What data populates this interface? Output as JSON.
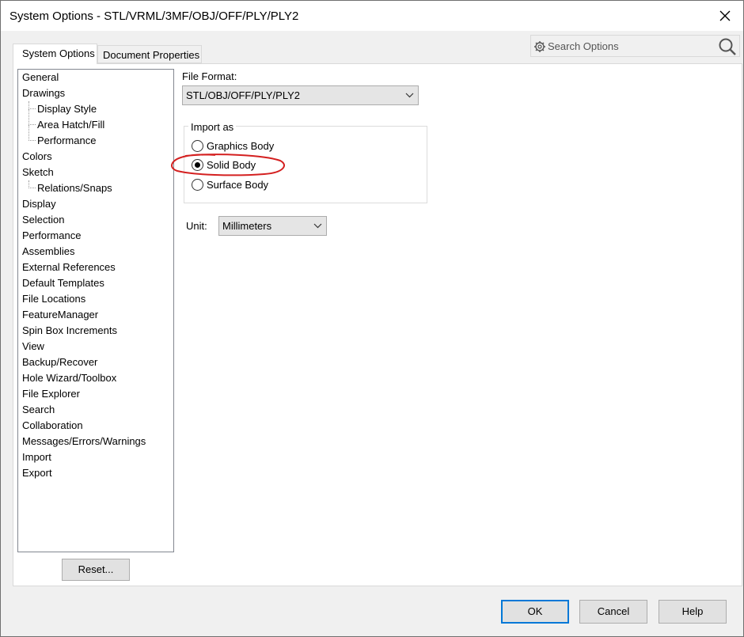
{
  "window": {
    "title": "System Options - STL/VRML/3MF/OBJ/OFF/PLY/PLY2"
  },
  "tabs": [
    {
      "label": "System Options",
      "active": true
    },
    {
      "label": "Document Properties",
      "active": false
    }
  ],
  "search": {
    "placeholder": "Search Options"
  },
  "nav": {
    "items": [
      {
        "label": "General",
        "level": 0
      },
      {
        "label": "Drawings",
        "level": 0
      },
      {
        "label": "Display Style",
        "level": 1
      },
      {
        "label": "Area Hatch/Fill",
        "level": 1
      },
      {
        "label": "Performance",
        "level": 1
      },
      {
        "label": "Colors",
        "level": 0
      },
      {
        "label": "Sketch",
        "level": 0
      },
      {
        "label": "Relations/Snaps",
        "level": 1
      },
      {
        "label": "Display",
        "level": 0
      },
      {
        "label": "Selection",
        "level": 0
      },
      {
        "label": "Performance",
        "level": 0
      },
      {
        "label": "Assemblies",
        "level": 0
      },
      {
        "label": "External References",
        "level": 0
      },
      {
        "label": "Default Templates",
        "level": 0
      },
      {
        "label": "File Locations",
        "level": 0
      },
      {
        "label": "FeatureManager",
        "level": 0
      },
      {
        "label": "Spin Box Increments",
        "level": 0
      },
      {
        "label": "View",
        "level": 0
      },
      {
        "label": "Backup/Recover",
        "level": 0
      },
      {
        "label": "Hole Wizard/Toolbox",
        "level": 0
      },
      {
        "label": "File Explorer",
        "level": 0
      },
      {
        "label": "Search",
        "level": 0
      },
      {
        "label": "Collaboration",
        "level": 0
      },
      {
        "label": "Messages/Errors/Warnings",
        "level": 0
      },
      {
        "label": "Import",
        "level": 0
      },
      {
        "label": "Export",
        "level": 0
      }
    ],
    "reset_label": "Reset..."
  },
  "file_format": {
    "label": "File Format:",
    "value": "STL/OBJ/OFF/PLY/PLY2"
  },
  "import_as": {
    "title": "Import as",
    "options": [
      {
        "label": "Graphics Body",
        "checked": false
      },
      {
        "label": "Solid Body",
        "checked": true
      },
      {
        "label": "Surface Body",
        "checked": false
      }
    ]
  },
  "unit": {
    "label": "Unit:",
    "value": "Millimeters"
  },
  "footer": {
    "ok": "OK",
    "cancel": "Cancel",
    "help": "Help"
  },
  "colors": {
    "annotation": "#d42020",
    "focus": "#0078d7"
  }
}
